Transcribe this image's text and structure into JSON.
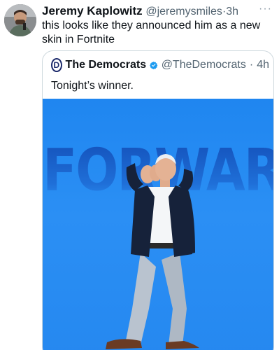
{
  "tweet": {
    "author_name": "Jeremy Kaplowitz",
    "author_handle": "@jeremysmiles",
    "separator": "·",
    "time": "3h",
    "more_label": "···",
    "text": "this looks like they announced him as a new skin in Fortnite"
  },
  "quoted": {
    "author_name": "The Democrats",
    "logo_letter": "D",
    "author_handle": "@TheDemocrats",
    "separator": "·",
    "time": "4h",
    "text": "Tonight’s winner.",
    "media": {
      "headline": "FORWARD",
      "background_color": "#2b8ff4"
    }
  },
  "colors": {
    "verified": "#1d9bf0",
    "secondary_text": "#536471",
    "border": "#cfd9de"
  }
}
